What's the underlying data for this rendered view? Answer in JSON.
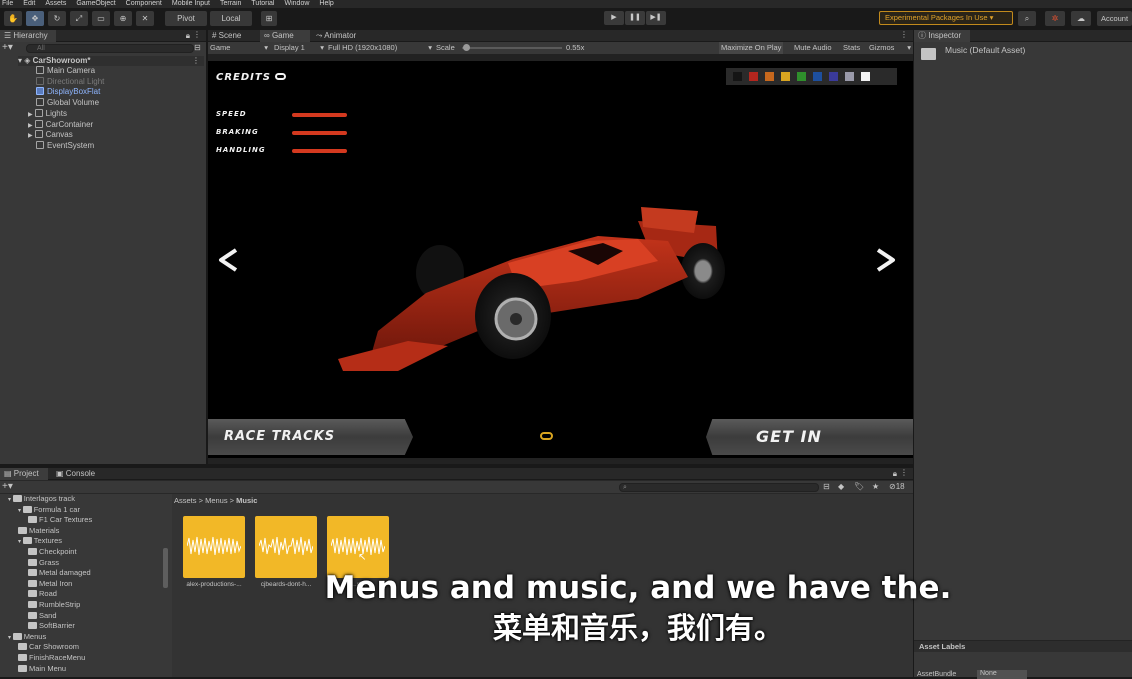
{
  "menubar": {
    "items": [
      "File",
      "Edit",
      "Assets",
      "GameObject",
      "Component",
      "Mobile Input",
      "Terrain",
      "Tutorial",
      "Window",
      "Help"
    ]
  },
  "toolbar": {
    "pivot": "Pivot",
    "local": "Local",
    "experimental": "Experimental Packages In Use ▾",
    "account": "Account",
    "play": "▶",
    "pause": "❚❚",
    "step": "▶❚"
  },
  "hierarchy": {
    "tab": "Hierarchy",
    "search_placeholder": "All",
    "scene": "CarShowroom*",
    "items": [
      {
        "label": "Main Camera"
      },
      {
        "label": "Directional Light"
      },
      {
        "label": "DisplayBoxFlat"
      },
      {
        "label": "Global Volume"
      },
      {
        "label": "Lights"
      },
      {
        "label": "CarContainer"
      },
      {
        "label": "Canvas"
      },
      {
        "label": "EventSystem"
      }
    ]
  },
  "tabs": {
    "scene": "Scene",
    "game": "Game",
    "animator": "Animator"
  },
  "gamebar": {
    "mode": "Game",
    "display": "Display 1",
    "resolution": "Full HD (1920x1080)",
    "scale_label": "Scale",
    "scale_value": "0.55x",
    "maximize": "Maximize On Play",
    "mute": "Mute Audio",
    "stats": "Stats",
    "gizmos": "Gizmos"
  },
  "game_ui": {
    "credits": "CREDITS",
    "credits_icon": "coin-icon",
    "stats": [
      {
        "label": "SPEED"
      },
      {
        "label": "BRAKING"
      },
      {
        "label": "HANDLING"
      }
    ],
    "swatches": [
      "#151515",
      "#b3261e",
      "#c7681d",
      "#d9a520",
      "#2f8f2c",
      "#1d4f9e",
      "#3a3a9a",
      "#9a9aaa",
      "#f2f2f2"
    ],
    "left_arrow": "<",
    "right_arrow": ">",
    "race_tracks": "RACE TRACKS",
    "get_in": "GET IN"
  },
  "inspector": {
    "tab": "Inspector",
    "title": "Music (Default Asset)",
    "asset_labels": "Asset Labels",
    "asset_bundle": "AssetBundle",
    "asset_bundle_value": "None"
  },
  "project": {
    "tab": "Project",
    "console_tab": "Console",
    "breadcrumb": [
      "Assets",
      "Menus",
      "Music"
    ],
    "count": "18",
    "tree": [
      {
        "label": "Interlagos track",
        "indent": 0
      },
      {
        "label": "Formula 1 car",
        "indent": 1
      },
      {
        "label": "F1 Car Textures",
        "indent": 2
      },
      {
        "label": "Materials",
        "indent": 1
      },
      {
        "label": "Textures",
        "indent": 1
      },
      {
        "label": "Checkpoint",
        "indent": 2
      },
      {
        "label": "Grass",
        "indent": 2
      },
      {
        "label": "Metal damaged",
        "indent": 2
      },
      {
        "label": "Metal Iron",
        "indent": 2
      },
      {
        "label": "Road",
        "indent": 2
      },
      {
        "label": "RumbleStrip",
        "indent": 2
      },
      {
        "label": "Sand",
        "indent": 2
      },
      {
        "label": "SoftBarrier",
        "indent": 2
      },
      {
        "label": "Menus",
        "indent": 0
      },
      {
        "label": "Car Showroom",
        "indent": 1
      },
      {
        "label": "FinishRaceMenu",
        "indent": 1
      },
      {
        "label": "Main Menu",
        "indent": 1
      }
    ],
    "assets": [
      {
        "label": "alex-productions-..."
      },
      {
        "label": "cjbeards-dont-h..."
      },
      {
        "label": "j...rf..."
      }
    ]
  },
  "subtitles": {
    "en": "Menus and music, and we have the.",
    "zh": "菜单和音乐，我们有。"
  }
}
